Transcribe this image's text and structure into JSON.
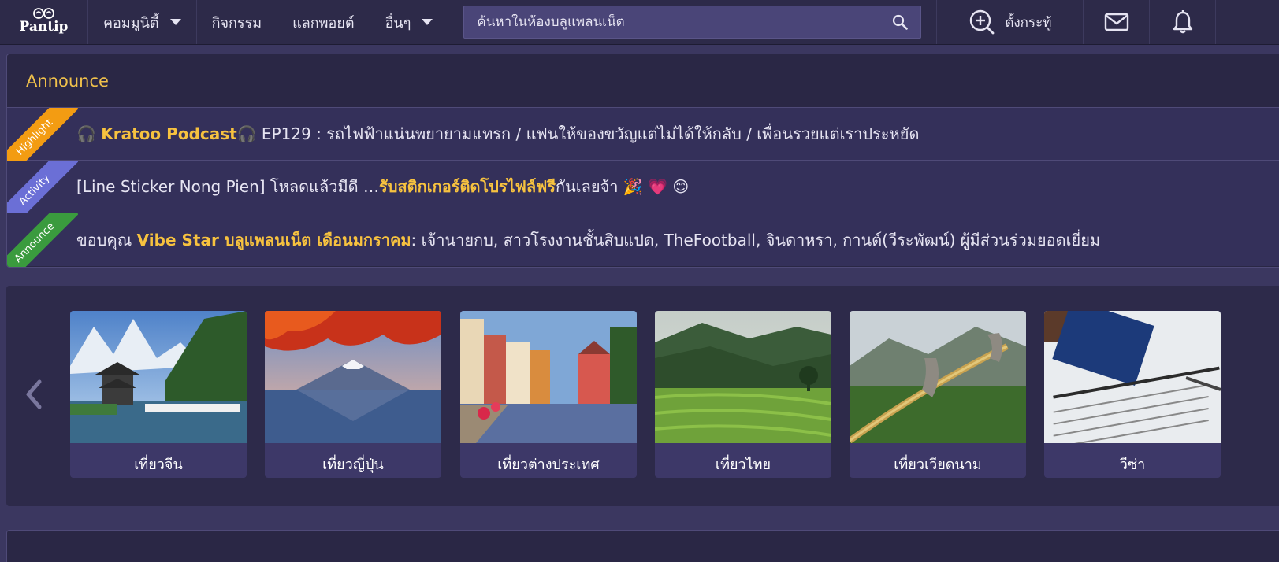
{
  "header": {
    "logo_text": "Pantip",
    "nav": [
      {
        "label": "คอมมูนิตี้",
        "has_caret": true
      },
      {
        "label": "กิจกรรม",
        "has_caret": false
      },
      {
        "label": "แลกพอยต์",
        "has_caret": false
      },
      {
        "label": "อื่นๆ",
        "has_caret": true
      }
    ],
    "search": {
      "placeholder": "ค้นหาในห้องบลูแพลนเน็ต",
      "icon": "search-icon"
    },
    "post_label": "ตั้งกระทู้",
    "icons": [
      "add-post-icon",
      "mail-icon",
      "bell-icon"
    ]
  },
  "announce": {
    "title": "Announce",
    "rows": [
      {
        "tag": "Highlight",
        "pre": "🎧 ",
        "bold": "Kratoo Podcast",
        "post": " 🎧 EP129 : รถไฟฟ้าแน่นพยายามแทรก / แฟนให้ของขวัญแต่ไม่ได้ให้กลับ / เพื่อนรวยแต่เราประหยัด"
      },
      {
        "tag": "Activity",
        "pre": "[Line Sticker Nong Pien] โหลดแล้วมีดี … ",
        "bold": "รับสติกเกอร์ติดโปรไฟล์ฟรี",
        "post": " กันเลยจ้า 🎉 💗 😊"
      },
      {
        "tag": "Announce",
        "pre": "ขอบคุณ ",
        "bold": "Vibe Star บลูแพลนเน็ต เดือนมกราคม",
        "post": " : เจ้านายกบ, สาวโรงงานชั้นสิบแปด, TheFootball, จินดาหรา, กานต์(วีระพัฒน์) ผู้มีส่วนร่วมยอดเยี่ยม"
      }
    ]
  },
  "carousel": {
    "prev_icon": "chevron-left-icon",
    "cards": [
      {
        "label": "เที่ยวจีน"
      },
      {
        "label": "เที่ยวญี่ปุ่น"
      },
      {
        "label": "เที่ยวต่างประเทศ"
      },
      {
        "label": "เที่ยวไทย"
      },
      {
        "label": "เที่ยวเวียดนาม"
      },
      {
        "label": "วีซ่า"
      }
    ]
  },
  "colors": {
    "accent": "#f7c23f",
    "background": "#3b3760",
    "topbar": "#2d2a49"
  }
}
